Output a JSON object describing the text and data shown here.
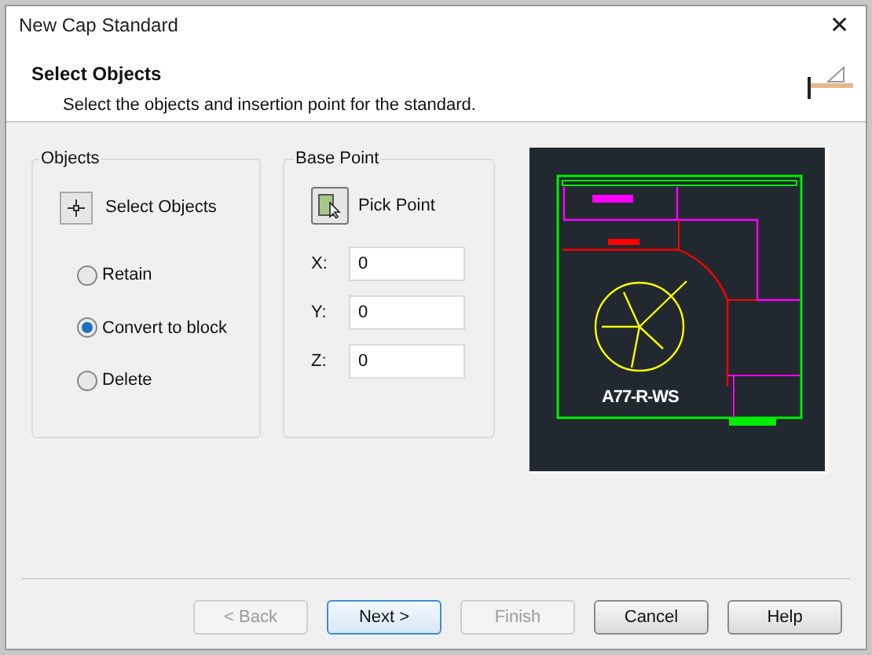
{
  "window": {
    "title": "New Cap Standard",
    "close": "✕"
  },
  "header": {
    "title": "Select Objects",
    "subtitle": "Select the objects and insertion point for the standard."
  },
  "objects": {
    "title": "Objects",
    "button": "Select Objects",
    "options": [
      {
        "label": "Retain",
        "selected": false
      },
      {
        "label": "Convert to block",
        "selected": true
      },
      {
        "label": "Delete",
        "selected": false
      }
    ]
  },
  "base_point": {
    "title": "Base Point",
    "button": "Pick Point",
    "fields": [
      {
        "label": "X:",
        "value": "0"
      },
      {
        "label": "Y:",
        "value": "0"
      },
      {
        "label": "Z:",
        "value": "0"
      }
    ]
  },
  "preview": {
    "label": "A77-R-WS"
  },
  "buttons": [
    {
      "label": "< Back",
      "disabled": true,
      "default": false
    },
    {
      "label": "Next >",
      "disabled": false,
      "default": true
    },
    {
      "label": "Finish",
      "disabled": true,
      "default": false
    },
    {
      "label": "Cancel",
      "disabled": false,
      "default": false
    },
    {
      "label": "Help",
      "disabled": false,
      "default": false
    }
  ]
}
